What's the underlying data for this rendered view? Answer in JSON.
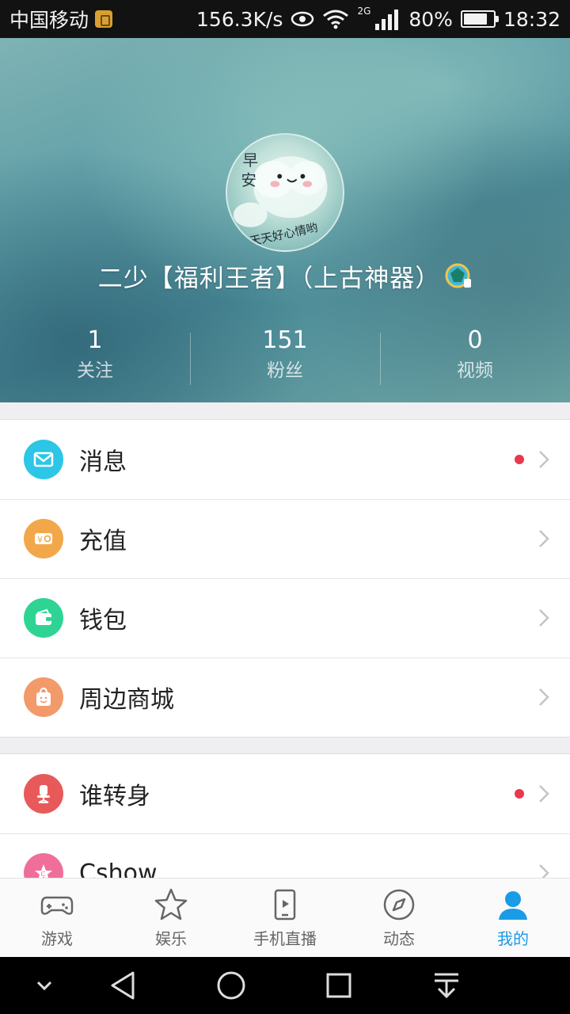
{
  "status_bar": {
    "carrier": "中国移动",
    "speed": "156.3K/s",
    "network_type": "2G",
    "battery": "80%",
    "time": "18:32"
  },
  "profile": {
    "username": "二少【福利王者】（上古神器）",
    "avatar_text": [
      "早",
      "安",
      "天天好心情哟"
    ],
    "stats": [
      {
        "value": "1",
        "label": "关注"
      },
      {
        "value": "151",
        "label": "粉丝"
      },
      {
        "value": "0",
        "label": "视频"
      }
    ]
  },
  "menu_group_1": [
    {
      "label": "消息",
      "icon": "mail-icon",
      "color": "#2cc6e6",
      "has_dot": true
    },
    {
      "label": "充值",
      "icon": "recharge-icon",
      "color": "#f2a84a",
      "has_dot": false
    },
    {
      "label": "钱包",
      "icon": "wallet-icon",
      "color": "#2fd494",
      "has_dot": false
    },
    {
      "label": "周边商城",
      "icon": "shopping-bag-icon",
      "color": "#f39a6a",
      "has_dot": false
    }
  ],
  "menu_group_2": [
    {
      "label": "谁转身",
      "icon": "chair-icon",
      "color": "#e85a5a",
      "has_dot": true
    },
    {
      "label": "Cshow",
      "icon": "star-badge-icon",
      "color": "#f06f9a",
      "has_dot": false
    }
  ],
  "tabs": [
    {
      "label": "游戏",
      "icon": "gamepad-icon",
      "active": false
    },
    {
      "label": "娱乐",
      "icon": "star-icon",
      "active": false
    },
    {
      "label": "手机直播",
      "icon": "phone-play-icon",
      "active": false
    },
    {
      "label": "动态",
      "icon": "compass-icon",
      "active": false
    },
    {
      "label": "我的",
      "icon": "person-icon",
      "active": true
    }
  ],
  "colors": {
    "accent": "#1a9be6",
    "dot": "#e8384f"
  }
}
